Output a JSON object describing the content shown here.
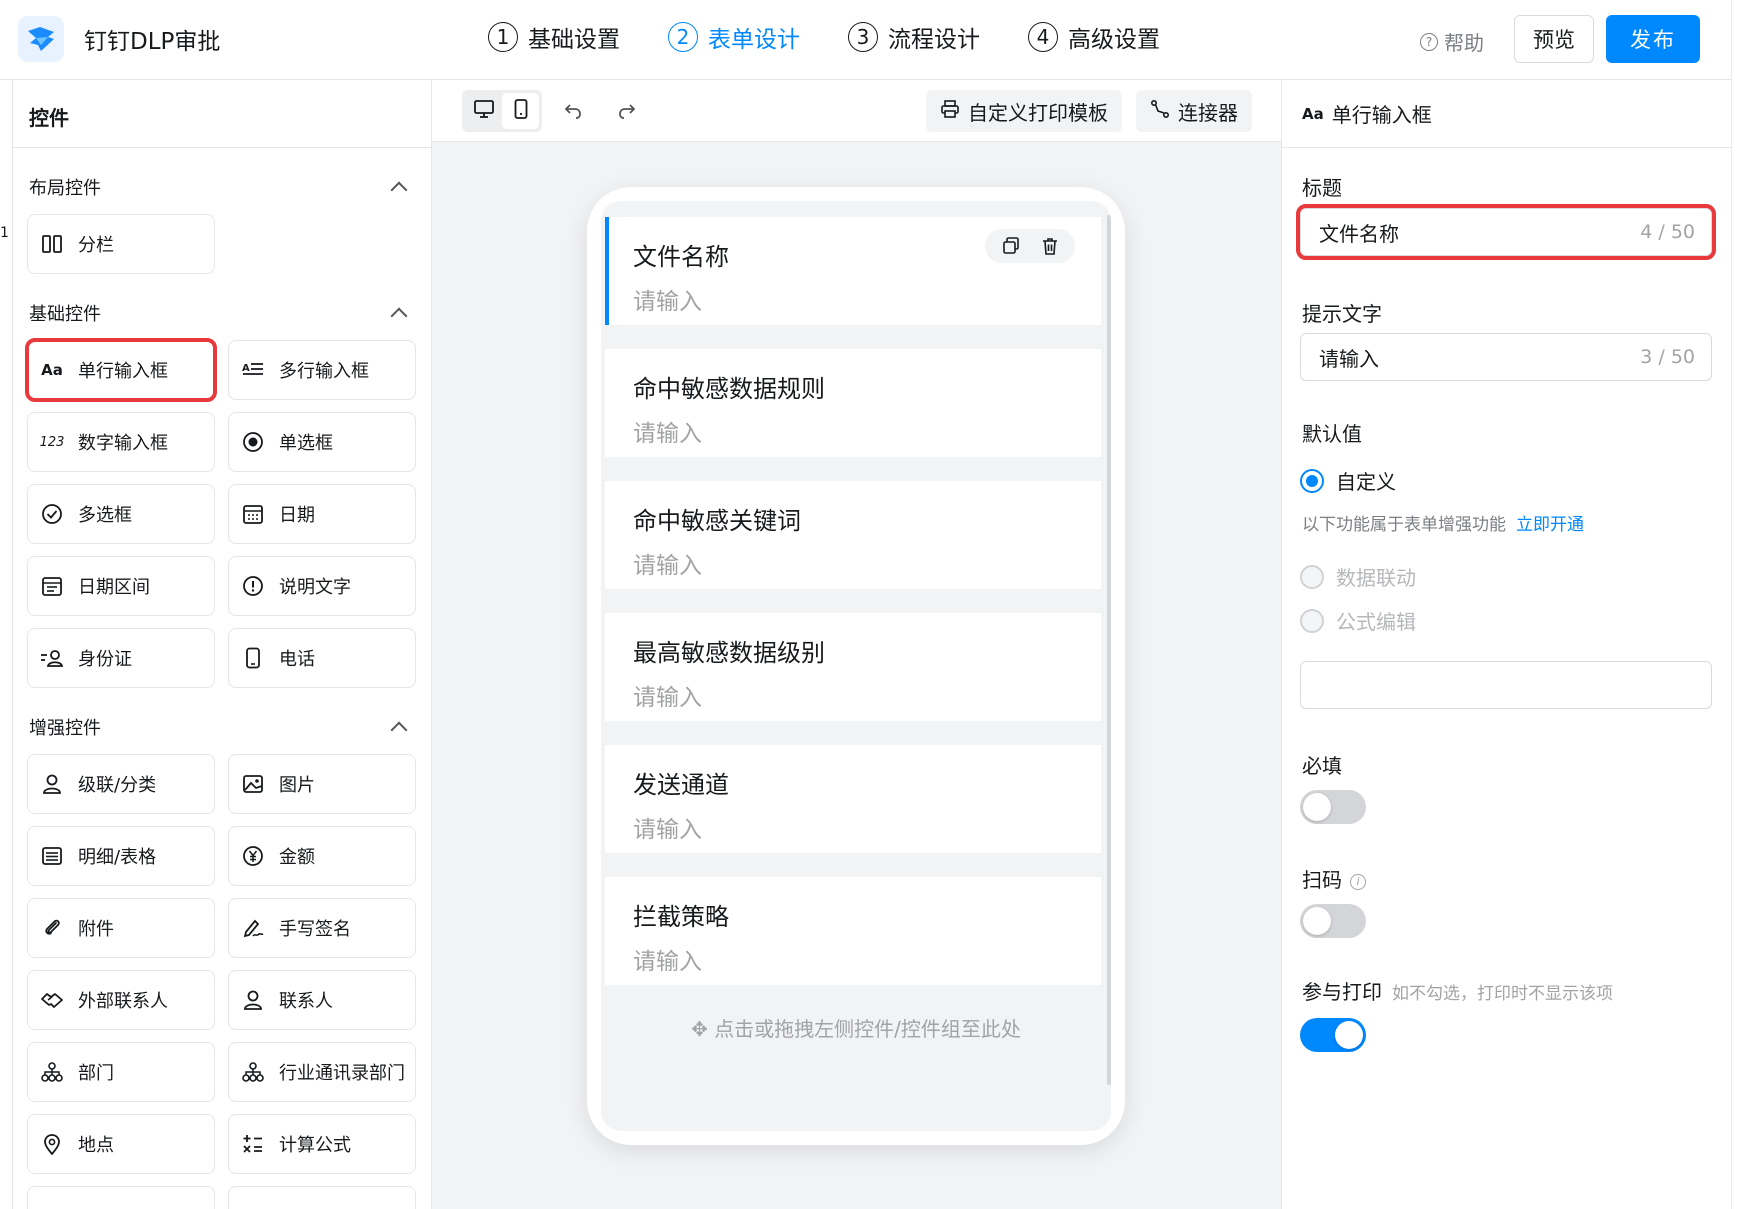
{
  "header": {
    "app_title": "钉钉DLP审批",
    "steps": [
      {
        "num": "1",
        "label": "基础设置"
      },
      {
        "num": "2",
        "label": "表单设计"
      },
      {
        "num": "3",
        "label": "流程设计"
      },
      {
        "num": "4",
        "label": "高级设置"
      }
    ],
    "active_step": 2,
    "help_label": "帮助",
    "preview_label": "预览",
    "publish_label": "发布"
  },
  "left_panel": {
    "title": "控件",
    "edge_mark": "1",
    "groups": [
      {
        "title": "布局控件",
        "items": [
          {
            "label": "分栏",
            "icon": "columns-icon"
          }
        ]
      },
      {
        "title": "基础控件",
        "items": [
          {
            "label": "单行输入框",
            "icon": "text-aa-icon",
            "selected": true
          },
          {
            "label": "多行输入框",
            "icon": "multiline-text-icon"
          },
          {
            "label": "数字输入框",
            "icon": "number-icon"
          },
          {
            "label": "单选框",
            "icon": "radio-icon"
          },
          {
            "label": "多选框",
            "icon": "checkbox-icon"
          },
          {
            "label": "日期",
            "icon": "calendar-icon"
          },
          {
            "label": "日期区间",
            "icon": "date-range-icon"
          },
          {
            "label": "说明文字",
            "icon": "exclamation-icon"
          },
          {
            "label": "身份证",
            "icon": "id-card-icon"
          },
          {
            "label": "电话",
            "icon": "phone-icon"
          }
        ]
      },
      {
        "title": "增强控件",
        "items": [
          {
            "label": "级联/分类",
            "icon": "cascade-icon"
          },
          {
            "label": "图片",
            "icon": "image-icon"
          },
          {
            "label": "明细/表格",
            "icon": "table-icon"
          },
          {
            "label": "金额",
            "icon": "yuan-icon"
          },
          {
            "label": "附件",
            "icon": "paperclip-icon"
          },
          {
            "label": "手写签名",
            "icon": "signature-icon"
          },
          {
            "label": "外部联系人",
            "icon": "handshake-icon"
          },
          {
            "label": "联系人",
            "icon": "person-icon"
          },
          {
            "label": "部门",
            "icon": "org-icon"
          },
          {
            "label": "行业通讯录部门",
            "icon": "org-icon"
          },
          {
            "label": "地点",
            "icon": "location-icon"
          },
          {
            "label": "计算公式",
            "icon": "formula-icon"
          }
        ]
      }
    ]
  },
  "toolbar": {
    "print_label": "自定义打印模板",
    "connector_label": "连接器"
  },
  "canvas": {
    "fields": [
      {
        "label": "文件名称",
        "placeholder": "请输入"
      },
      {
        "label": "命中敏感数据规则",
        "placeholder": "请输入"
      },
      {
        "label": "命中敏感关键词",
        "placeholder": "请输入"
      },
      {
        "label": "最高敏感数据级别",
        "placeholder": "请输入"
      },
      {
        "label": "发送通道",
        "placeholder": "请输入"
      },
      {
        "label": "拦截策略",
        "placeholder": "请输入"
      }
    ],
    "drop_hint": "点击或拖拽左侧控件/控件组至此处"
  },
  "right_panel": {
    "header_icon_text": "Aa",
    "header_title": "单行输入框",
    "title_label": "标题",
    "title_value": "文件名称",
    "title_count": "4 / 50",
    "hint_label": "提示文字",
    "hint_value": "请输入",
    "hint_count": "3 / 50",
    "default_label": "默认值",
    "default_option": "自定义",
    "enhance_note": "以下功能属于表单增强功能",
    "enhance_link": "立即开通",
    "disabled_options": [
      "数据联动",
      "公式编辑"
    ],
    "required_label": "必填",
    "required_on": false,
    "scan_label": "扫码",
    "scan_on": false,
    "print_label": "参与打印",
    "print_hint": "如不勾选，打印时不显示该项",
    "print_on": true
  },
  "colors": {
    "accent": "#0089ff",
    "highlight_box": "#e8393d"
  }
}
